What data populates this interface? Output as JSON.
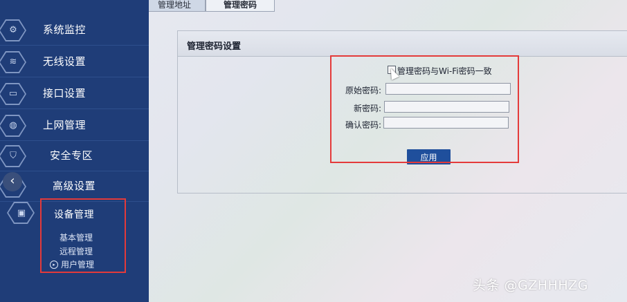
{
  "tabs": [
    {
      "label": "管理地址"
    },
    {
      "label": "管理密码"
    }
  ],
  "sidebar": {
    "items": [
      {
        "label": "系统监控",
        "icon": "gear-icon"
      },
      {
        "label": "无线设置",
        "icon": "wifi-icon"
      },
      {
        "label": "接口设置",
        "icon": "interface-icon"
      },
      {
        "label": "上网管理",
        "icon": "globe-icon"
      },
      {
        "label": "安全专区",
        "icon": "shield-icon"
      },
      {
        "label": "高级设置",
        "icon": "advanced-settings-icon"
      }
    ],
    "device_management": {
      "label": "设备管理",
      "icon": "device-management-icon",
      "sub_items": [
        {
          "label": "基本管理"
        },
        {
          "label": "远程管理"
        },
        {
          "label": "用户管理"
        }
      ]
    },
    "back_icon": "chevron-left-icon"
  },
  "panel": {
    "title": "管理密码设置",
    "sync_checkbox_label": "管理密码与Wi-Fi密码一致",
    "sync_checked": false,
    "fields": [
      {
        "label": "原始密码:",
        "value": ""
      },
      {
        "label": "新密码:",
        "value": ""
      },
      {
        "label": "确认密码:",
        "value": ""
      }
    ],
    "apply_label": "应用"
  },
  "watermark": "头条 @GZHHHZG",
  "colors": {
    "sidebar_bg": "#1f3d78",
    "apply_button": "#1f4f9c",
    "highlight_box": "#e43a3a"
  }
}
